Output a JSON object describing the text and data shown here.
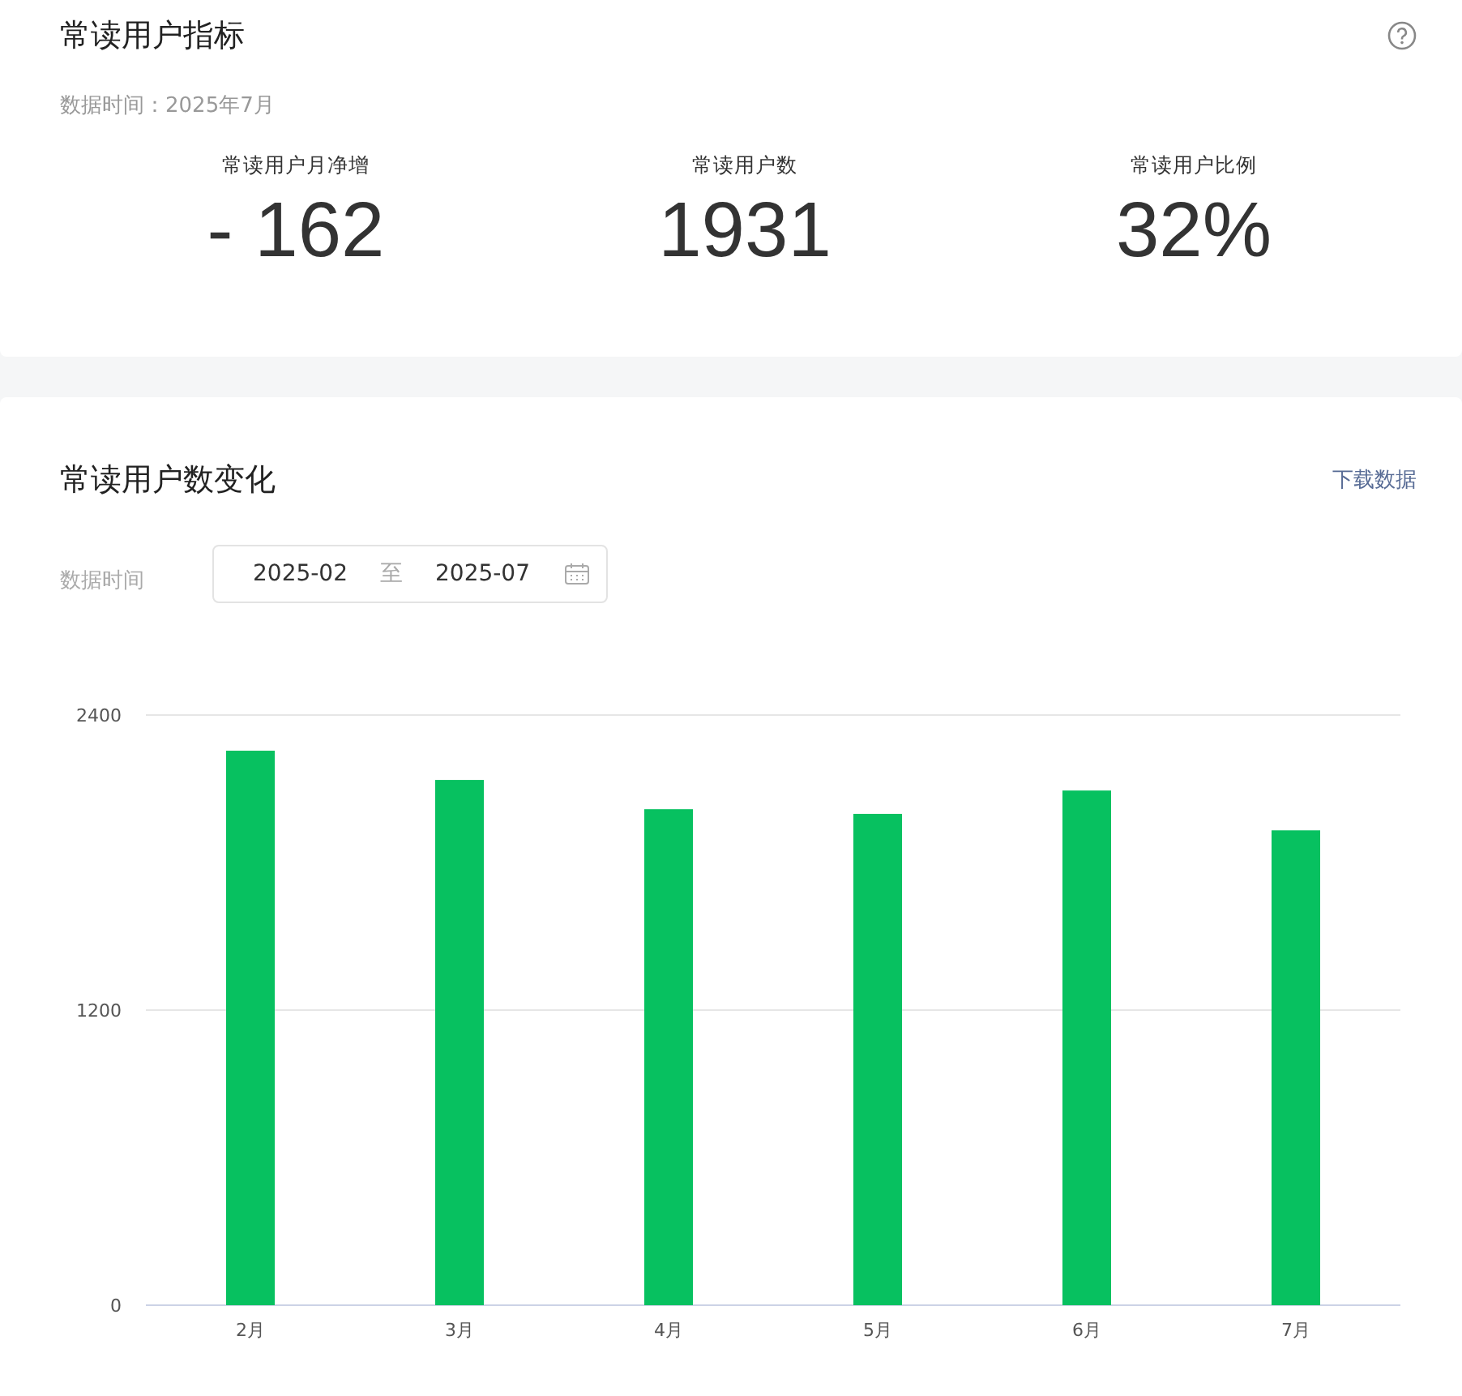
{
  "indicators": {
    "title": "常读用户指标",
    "data_time": "数据时间：2025年7月",
    "metrics": [
      {
        "label": "常读用户月净增",
        "value": "- 162"
      },
      {
        "label": "常读用户数",
        "value": "1931"
      },
      {
        "label": "常读用户比例",
        "value": "32%"
      }
    ]
  },
  "trend": {
    "title": "常读用户数变化",
    "download_link": "下载数据",
    "filter_label": "数据时间",
    "start_date": "2025-02",
    "range_separator": "至",
    "end_date": "2025-07",
    "chart_data": {
      "type": "bar",
      "categories": [
        "2月",
        "3月",
        "4月",
        "5月",
        "6月",
        "7月"
      ],
      "series": [
        {
          "color": "#07c160",
          "values": [
            2255,
            2136,
            2017,
            1998,
            2093,
            1931
          ]
        }
      ],
      "ylim": [
        0,
        2400
      ],
      "yticks": [
        0,
        1200,
        2400
      ]
    }
  }
}
